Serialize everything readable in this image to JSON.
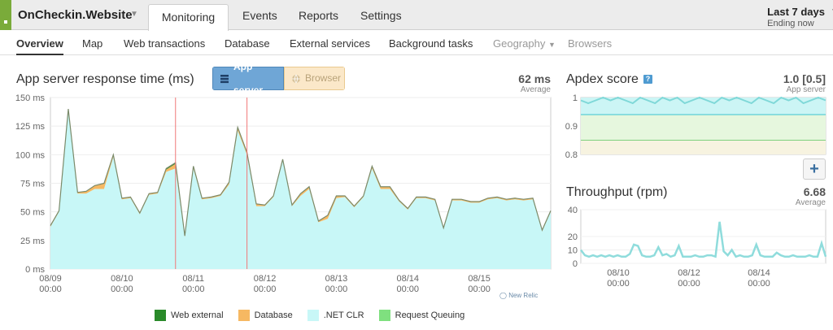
{
  "header": {
    "app_name": "OnCheckin.Website",
    "tabs": [
      "Monitoring",
      "Events",
      "Reports",
      "Settings"
    ],
    "range_title": "Last 7 days",
    "range_sub": "Ending now"
  },
  "subnav": [
    "Overview",
    "Map",
    "Web transactions",
    "Database",
    "External services",
    "Background tasks",
    "Geography",
    "Browsers"
  ],
  "response_panel": {
    "title": "App server response time (ms)",
    "toggle": [
      "App server",
      "Browser"
    ],
    "metric_value": "62 ms",
    "metric_label": "Average",
    "legend": [
      "Web external",
      "Database",
      ".NET CLR",
      "Request Queuing"
    ],
    "legend_colors": [
      "#2a8a2a",
      "#f6b862",
      "#c8f7f7",
      "#7fe07f"
    ],
    "watermark": "New Relic"
  },
  "apdex_panel": {
    "title": "Apdex score",
    "help_icon": "?",
    "metric_value": "1.0 [0.5]",
    "metric_label": "App server"
  },
  "throughput_panel": {
    "title": "Throughput (rpm)",
    "metric_value": "6.68",
    "metric_label": "Average",
    "add_button": "+"
  },
  "chart_data": [
    {
      "type": "area",
      "title": "App server response time (ms)",
      "ylabel": "",
      "ylim": [
        0,
        150
      ],
      "yticks": [
        "0 ms",
        "25 ms",
        "50 ms",
        "75 ms",
        "100 ms",
        "125 ms",
        "150 ms"
      ],
      "xtick_labels": [
        "08/09 00:00",
        "08/10 00:00",
        "08/11 00:00",
        "08/12 00:00",
        "08/13 00:00",
        "08/14 00:00",
        "08/15 00:00"
      ],
      "x_days": [
        0,
        0.12,
        0.25,
        0.38,
        0.5,
        0.62,
        0.75,
        0.88,
        1.0,
        1.12,
        1.25,
        1.38,
        1.5,
        1.62,
        1.75,
        1.88,
        2.0,
        2.12,
        2.25,
        2.38,
        2.5,
        2.62,
        2.75,
        2.88,
        3.0,
        3.12,
        3.25,
        3.38,
        3.5,
        3.62,
        3.75,
        3.88,
        4.0,
        4.12,
        4.25,
        4.38,
        4.5,
        4.62,
        4.75,
        4.88,
        5.0,
        5.12,
        5.25,
        5.38,
        5.5,
        5.62,
        5.75,
        5.88,
        6.0,
        6.12,
        6.25,
        6.38,
        6.5,
        6.62,
        6.75,
        6.88,
        7.0
      ],
      "series": [
        {
          "name": ".NET CLR",
          "color": "#c8f7f7",
          "values": [
            37,
            50,
            138,
            66,
            66,
            70,
            70,
            98,
            61,
            62,
            48,
            65,
            66,
            85,
            88,
            28,
            88,
            61,
            62,
            64,
            74,
            121,
            100,
            55,
            55,
            63,
            95,
            55,
            64,
            70,
            41,
            44,
            62,
            63,
            54,
            63,
            88,
            70,
            70,
            59,
            52,
            62,
            62,
            60,
            35,
            60,
            60,
            58,
            58,
            61,
            62,
            60,
            61,
            60,
            61,
            33,
            50
          ]
        },
        {
          "name": "Database",
          "color": "#f6b862",
          "values": [
            1,
            1,
            2,
            1,
            2,
            3,
            5,
            2,
            1,
            1,
            1,
            1,
            1,
            2,
            4,
            1,
            2,
            1,
            1,
            1,
            2,
            3,
            2,
            2,
            1,
            1,
            1,
            1,
            2,
            2,
            1,
            3,
            2,
            1,
            1,
            1,
            2,
            2,
            2,
            1,
            1,
            1,
            1,
            1,
            1,
            1,
            1,
            1,
            1,
            1,
            1,
            1,
            1,
            1,
            1,
            1,
            1
          ]
        },
        {
          "name": "Web external",
          "color": "#2a8a2a",
          "values": [
            0,
            0,
            0,
            0,
            0,
            0,
            0,
            0,
            0,
            0,
            0,
            0,
            0,
            1,
            1,
            0,
            0,
            0,
            0,
            0,
            0,
            0,
            0,
            0,
            0,
            0,
            0,
            0,
            0,
            0,
            0,
            0,
            0,
            0,
            0,
            0,
            0,
            0,
            0,
            0,
            0,
            0,
            0,
            0,
            0,
            0,
            0,
            0,
            0,
            0,
            0,
            0,
            0,
            0,
            0,
            0,
            0
          ]
        },
        {
          "name": "Request Queuing",
          "color": "#7fe07f",
          "values": [
            0,
            0,
            0,
            0,
            0,
            0,
            0,
            0,
            0,
            0,
            0,
            0,
            0,
            0,
            0,
            0,
            0,
            0,
            0,
            0,
            0,
            0,
            0,
            0,
            0,
            0,
            0,
            0,
            0,
            0,
            0,
            0,
            0,
            0,
            0,
            0,
            0,
            0,
            0,
            0,
            0,
            0,
            0,
            0,
            0,
            0,
            0,
            0,
            0,
            0,
            0,
            0,
            0,
            0,
            0,
            0,
            0
          ]
        }
      ],
      "event_markers_days": [
        1.75,
        2.75
      ]
    },
    {
      "type": "line",
      "title": "Apdex score",
      "ylim": [
        0.8,
        1.0
      ],
      "yticks": [
        "0.8",
        "0.9",
        "1"
      ],
      "threshold_lines": [
        0.94,
        0.85
      ],
      "values": [
        0.99,
        0.98,
        0.99,
        1,
        0.99,
        1,
        0.99,
        0.98,
        1,
        0.99,
        0.98,
        1,
        0.99,
        1,
        0.98,
        0.99,
        1,
        0.99,
        0.98,
        1,
        0.99,
        1,
        0.99,
        0.98,
        1,
        0.99,
        0.98,
        1,
        0.99,
        1,
        0.98,
        0.99,
        1,
        0.99
      ]
    },
    {
      "type": "line",
      "title": "Throughput (rpm)",
      "ylim": [
        0,
        40
      ],
      "yticks": [
        "0",
        "10",
        "20",
        "40"
      ],
      "xtick_labels": [
        "08/10 00:00",
        "08/12 00:00",
        "08/14 00:00"
      ],
      "values": [
        10,
        6,
        5,
        6,
        5,
        6,
        5,
        6,
        5,
        6,
        5,
        5,
        7,
        14,
        13,
        6,
        5,
        5,
        6,
        12,
        6,
        7,
        5,
        6,
        13,
        5,
        5,
        5,
        6,
        5,
        5,
        6,
        6,
        5,
        31,
        9,
        6,
        10,
        5,
        6,
        5,
        5,
        6,
        14,
        6,
        5,
        5,
        5,
        8,
        6,
        5,
        5,
        6,
        5,
        5,
        5,
        6,
        5,
        5,
        15,
        5
      ]
    }
  ]
}
